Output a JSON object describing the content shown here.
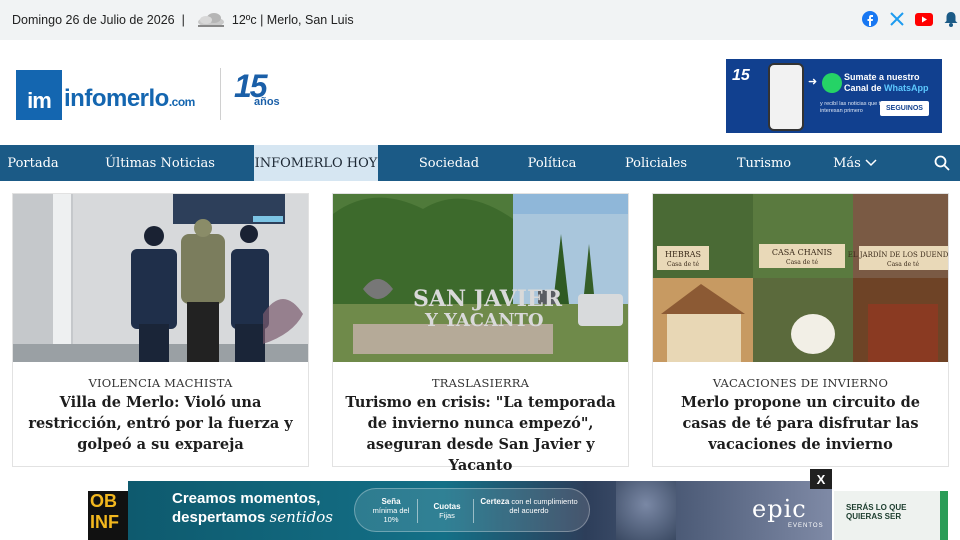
{
  "topbar": {
    "date": "Domingo 26 de Julio de 2026",
    "separator": "|",
    "weather": "12ºc | Merlo, San Luis",
    "weather_icon": "cloud-icon"
  },
  "social": {
    "facebook_icon": "facebook-icon",
    "x_icon": "x-twitter-icon",
    "youtube_icon": "youtube-icon",
    "bell_icon": "bell-icon",
    "colors": {
      "facebook": "#1877f2",
      "x": "#1d9bf0",
      "youtube": "#ff0000",
      "bell": "#1b5a86"
    }
  },
  "header": {
    "logo_mark": "im",
    "logo_name": "infomerlo",
    "logo_domain": ".com",
    "anniversary_number": "15",
    "anniversary_label": "años",
    "whatsapp_banner": {
      "number": "15",
      "line1": "Sumate a nuestro",
      "line2_prefix": "Canal de ",
      "line2_highlight": "WhatsApp",
      "small_text": "y recibí las noticias que te interesan primero",
      "button": "SEGUINOS"
    }
  },
  "nav": {
    "items": [
      {
        "label": "Portada"
      },
      {
        "label": "Últimas Noticias"
      },
      {
        "label": "INFOMERLO HOY",
        "active": true
      },
      {
        "label": "Sociedad"
      },
      {
        "label": "Política"
      },
      {
        "label": "Policiales"
      },
      {
        "label": "Turismo"
      },
      {
        "label": "Más"
      }
    ],
    "search_icon": "search-icon",
    "colors": {
      "bar": "#1b5a86",
      "active_bg": "#d6e6f2"
    }
  },
  "articles": [
    {
      "category": "VIOLENCIA MACHISTA",
      "title": "Villa de Merlo: Violó una restricción, entró por la fuerza y golpeó a su expareja",
      "image_sign": "POLICÍA DE SAN LUIS"
    },
    {
      "category": "TRASLASIERRA",
      "title": "Turismo en crisis: \"La temporada de invierno nunca empezó\", aseguran desde San Javier y Yacanto",
      "image_sign": "SAN JAVIER Y YACANTO"
    },
    {
      "category": "VACACIONES DE INVIERNO",
      "title": "Merlo propone un circuito de casas de té para disfrutar las vacaciones de invierno",
      "image_labels": [
        "HEBRAS",
        "Casa de té",
        "CASA CHANIS",
        "Casa de té",
        "EL JARDÍN DE LOS DUENDES",
        "Casa de té"
      ]
    }
  ],
  "ads": {
    "left_text": "OB INF",
    "main_line1": "Creamos momentos,",
    "main_line2_plain": "despertamos ",
    "main_line2_script": "sentidos",
    "pill": [
      {
        "bold": "Seña",
        "rest": "mínima del 10%"
      },
      {
        "bold": "Cuotas",
        "rest": "Fijas"
      },
      {
        "bold": "Certeza",
        "rest": "con el cumplimiento del acuerdo"
      }
    ],
    "brand": "epic",
    "brand_sub": "EVENTOS",
    "right_text": "SERÁS LO QUE QUIERAS SER",
    "close": "X"
  }
}
